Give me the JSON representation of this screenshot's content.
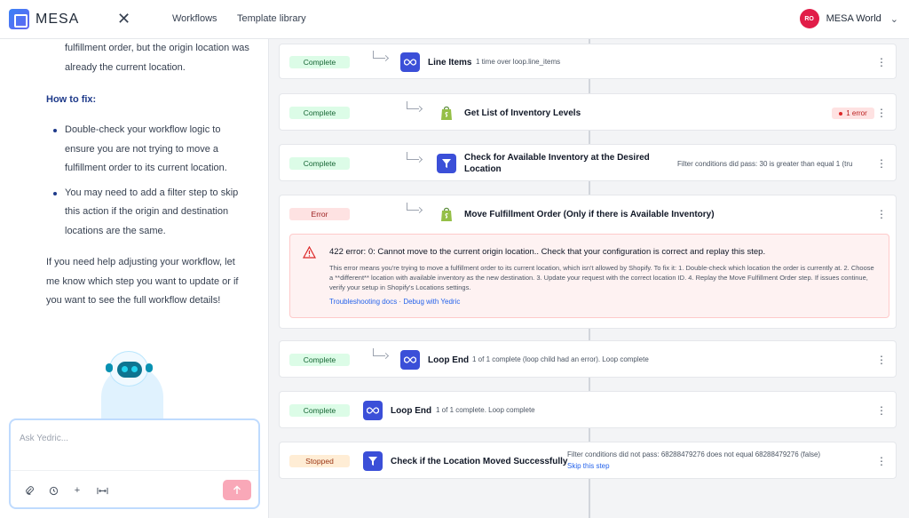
{
  "app": {
    "name": "MESA"
  },
  "topbar": {
    "nav": [
      "Workflows",
      "Template library"
    ],
    "account": {
      "initials": "RO",
      "name": "MESA World"
    }
  },
  "chat": {
    "intro": "fulfillment order, but the origin location was already the current location.",
    "fix_heading": "How to fix:",
    "fix_items": [
      "Double-check your workflow logic to ensure you are not trying to move a fulfillment order to its current location.",
      "You may need to add a filter step to skip this action if the origin and destination locations are the same."
    ],
    "help": "If you need help adjusting your workflow, let me know which step you want to update or if you want to see the full workflow details!",
    "composer_placeholder": "Ask Yedric..."
  },
  "steps": [
    {
      "status": "Complete",
      "title": "Line Items",
      "meta": "1 time over loop.line_items",
      "icon": "loop-icon"
    },
    {
      "status": "Complete",
      "title": "Get List of Inventory Levels",
      "meta": "",
      "icon": "shopify-icon",
      "error_pill": "1 error"
    },
    {
      "status": "Complete",
      "title": "Check for Available Inventory at the Desired Location",
      "meta": "Filter conditions did pass: 30 is greater than equal 1 (tru",
      "icon": "filter-icon"
    },
    {
      "status": "Error",
      "title": "Move Fulfillment Order (Only if there is Available Inventory)",
      "meta": "",
      "icon": "shopify-icon"
    },
    {
      "status": "Complete",
      "title": "Loop End",
      "meta": "1 of 1 complete (loop child had an error). Loop complete",
      "icon": "loop-icon"
    },
    {
      "status": "Complete",
      "title": "Loop End",
      "meta": "1 of 1 complete. Loop complete",
      "icon": "loop-icon"
    },
    {
      "status": "Stopped",
      "title": "Check if the Location Moved Successfully",
      "meta": "Filter conditions did not pass: 68288479276 does not equal 68288479276 (false)",
      "icon": "filter-icon",
      "link": "Skip this step"
    }
  ],
  "error": {
    "title": "422 error: 0: Cannot move to the current origin location.. Check that your configuration is correct and replay this step.",
    "body": "This error means you're trying to move a fulfillment order to its current location, which isn't allowed by Shopify. To fix it: 1. Double-check which location the order is currently at. 2. Choose a **different** location with available inventory as the new destination. 3. Update your request with the correct location ID. 4. Replay the Move Fulfillment Order step. If issues continue, verify your setup in Shopify's Locations settings.",
    "link_docs": "Troubleshooting docs",
    "separator": " · ",
    "link_debug": "Debug with Yedric"
  }
}
